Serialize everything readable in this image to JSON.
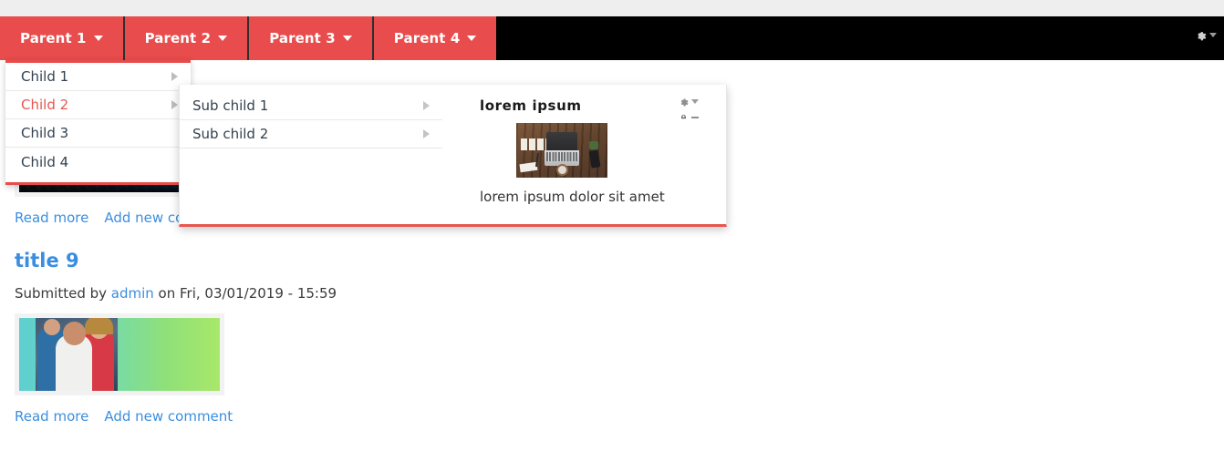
{
  "theme": {
    "menu_red": "#e84c4c",
    "accent_red": "#e8564f",
    "link_blue": "#3b8ede",
    "header_black": "#000000",
    "text_dark": "#33414f"
  },
  "header": {
    "gear_icon": "gear-icon",
    "caret_icon": "caret-down-icon"
  },
  "menubar": {
    "items": [
      {
        "label": "Parent 1"
      },
      {
        "label": "Parent 2"
      },
      {
        "label": "Parent 3"
      },
      {
        "label": "Parent 4"
      }
    ]
  },
  "child_menu": {
    "items": [
      {
        "label": "Child 1",
        "has_arrow": true,
        "active": false
      },
      {
        "label": "Child 2",
        "has_arrow": true,
        "active": true
      },
      {
        "label": "Child 3",
        "has_arrow": false,
        "active": false
      },
      {
        "label": "Child 4",
        "has_arrow": false,
        "active": false
      }
    ]
  },
  "sub_menu": {
    "items": [
      {
        "label": "Sub child 1",
        "has_arrow": true
      },
      {
        "label": "Sub child 2",
        "has_arrow": true
      }
    ]
  },
  "promo": {
    "title": "lorem ipsum",
    "caption": "lorem ipsum dolor sit amet",
    "image_alt": "desk-with-laptop-photo",
    "contextual": {
      "gear_icon": "gear-icon",
      "caret_icon": "caret-down-icon",
      "pencil_icon": "pencil-icon"
    }
  },
  "content": {
    "nodes": [
      {
        "title": "",
        "submitted_prefix": "",
        "author": "",
        "submitted_suffix": "",
        "image_alt": "circuit-board-tech-photo",
        "read_more": "Read more",
        "add_comment": "Add new comment"
      },
      {
        "title": "title 9",
        "submitted_prefix": "Submitted by ",
        "author": "admin",
        "submitted_suffix": " on Fri, 03/01/2019 - 15:59",
        "image_alt": "three-people-gradient-banner-photo",
        "read_more": "Read more",
        "add_comment": "Add new comment"
      }
    ]
  }
}
